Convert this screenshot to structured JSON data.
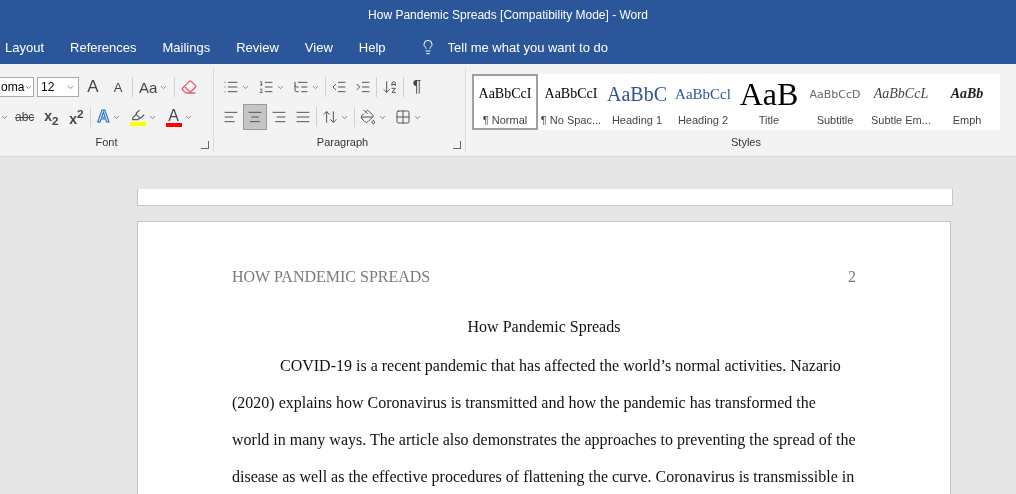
{
  "window": {
    "title": "How Pandemic Spreads [Compatibility Mode]  -  Word"
  },
  "tabs": [
    {
      "label": "Layout",
      "selected": false
    },
    {
      "label": "References",
      "selected": false
    },
    {
      "label": "Mailings",
      "selected": false
    },
    {
      "label": "Review",
      "selected": false
    },
    {
      "label": "View",
      "selected": false
    },
    {
      "label": "Help",
      "selected": false
    }
  ],
  "tell_me": {
    "placeholder": "Tell me what you want to do"
  },
  "font_group": {
    "label": "Font",
    "font_name": "oma",
    "font_size": "12",
    "row1": [
      {
        "kind": "grow",
        "text": "A"
      },
      {
        "kind": "shrink",
        "text": "A"
      },
      {
        "kind": "case",
        "text": "Aa"
      },
      {
        "kind": "clear"
      }
    ],
    "row2": [
      {
        "kind": "strike",
        "text": "abc"
      },
      {
        "kind": "sub",
        "text": "x$_{2}$"
      },
      {
        "kind": "sup",
        "text": "x$^{2}$"
      },
      {
        "kind": "effects",
        "text": "A"
      },
      {
        "kind": "highlight",
        "color": "#ffff00"
      },
      {
        "kind": "fontcolor",
        "text": "A",
        "color": "#ff0000"
      }
    ]
  },
  "paragraph_group": {
    "label": "Paragraph",
    "row1": [
      {
        "kind": "bullets"
      },
      {
        "kind": "numbering"
      },
      {
        "kind": "multilevel"
      },
      {
        "kind": "outdent"
      },
      {
        "kind": "indent"
      },
      {
        "kind": "sort"
      },
      {
        "kind": "marks",
        "text": "¶"
      }
    ],
    "row2": [
      {
        "kind": "left",
        "selected": false
      },
      {
        "kind": "center",
        "selected": true
      },
      {
        "kind": "right",
        "selected": false
      },
      {
        "kind": "justify",
        "selected": false
      },
      {
        "kind": "spacing"
      },
      {
        "kind": "shading"
      },
      {
        "kind": "borders"
      }
    ]
  },
  "styles_group": {
    "label": "Styles",
    "items": [
      {
        "kind": "normal",
        "preview": "AaBbCcI",
        "name": "¶ Normal",
        "selected": true
      },
      {
        "kind": "normal",
        "preview": "AaBbCcI",
        "name": "¶ No Spac...",
        "selected": false
      },
      {
        "kind": "heading1",
        "preview": "AaBbC",
        "name": "Heading 1",
        "selected": false
      },
      {
        "kind": "heading2",
        "preview": "AaBbCcl",
        "name": "Heading 2",
        "selected": false
      },
      {
        "kind": "title",
        "preview": "AaB",
        "name": "Title",
        "selected": false
      },
      {
        "kind": "subtitle",
        "preview": "AaBbCcD",
        "name": "Subtitle",
        "selected": false
      },
      {
        "kind": "subtle",
        "preview": "AaBbCcL",
        "name": "Subtle Em...",
        "selected": false
      },
      {
        "kind": "emphasis",
        "preview": "AaBb",
        "name": "Emph",
        "selected": false
      }
    ]
  },
  "document": {
    "header": "HOW PANDEMIC SPREADS",
    "page_number": "2",
    "title": "How Pandemic Spreads",
    "paragraph": "COVID-19 is a recent pandemic that has affected the world’s normal activities. Nazario (2020) explains how Coronavirus is transmitted and how the pandemic has transformed the world in many ways. The article also demonstrates the approaches to preventing the spread of the disease as well as the effective procedures of flattening the curve. Coronavirus is transmissible in"
  }
}
